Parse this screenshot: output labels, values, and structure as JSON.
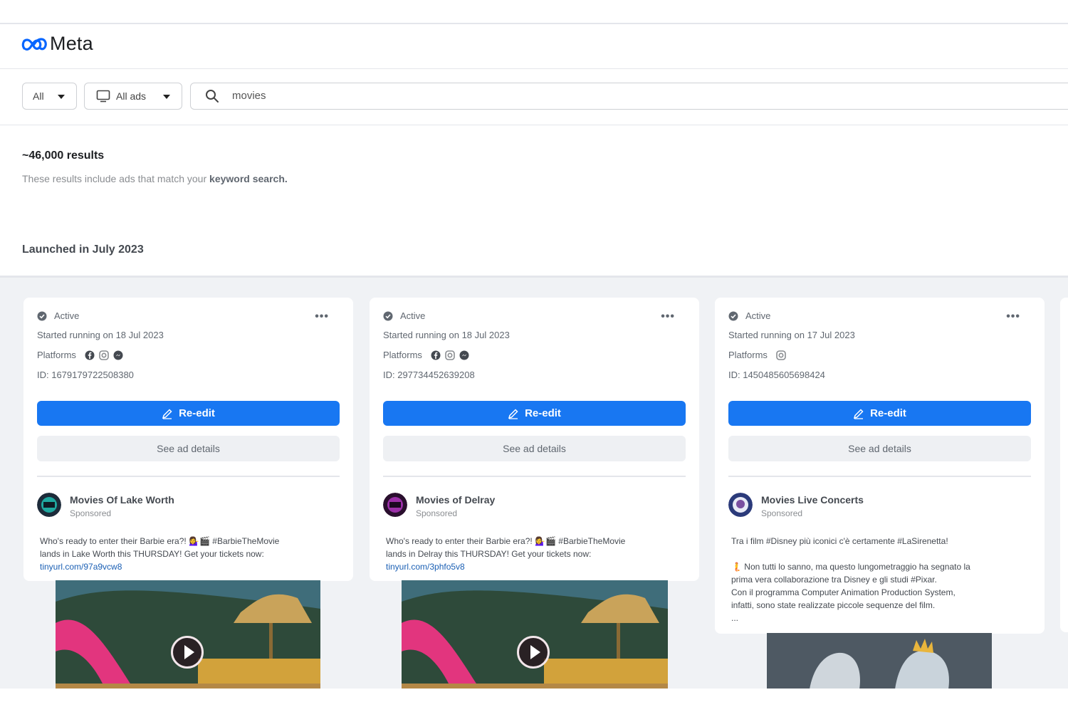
{
  "app": {
    "logo_text": "Meta"
  },
  "filters": {
    "country": "All",
    "ad_category": "All ads",
    "search_value": "movies"
  },
  "results": {
    "count_label": "~46,000 results",
    "note_prefix": "These results include ads that match your",
    "note_emphasis": "keyword search."
  },
  "section": {
    "title": "Launched in July 2023"
  },
  "colors": {
    "accent": "#1877f2",
    "background": "#f0f2f5"
  },
  "cards": [
    {
      "status": "Active",
      "started": "Started running on 18 Jul 2023",
      "platforms_label": "Platforms",
      "platforms": [
        "facebook-icon",
        "instagram-icon",
        "messenger-icon"
      ],
      "id": "ID: 1679179722508380",
      "reedit_label": "Re-edit",
      "details_label": "See ad details",
      "advertiser": "Movies Of Lake Worth",
      "sponsored": "Sponsored",
      "text_line1": "Who's ready to enter their Barbie era?! 💁‍♀️🎬 #BarbieTheMovie",
      "text_line2": "lands in Lake Worth this THURSDAY! Get your tickets now:",
      "link": "tinyurl.com/97a9vcw8"
    },
    {
      "status": "Active",
      "started": "Started running on 18 Jul 2023",
      "platforms_label": "Platforms",
      "platforms": [
        "facebook-icon",
        "instagram-icon",
        "messenger-icon"
      ],
      "id": "ID: 297734452639208",
      "reedit_label": "Re-edit",
      "details_label": "See ad details",
      "advertiser": "Movies of Delray",
      "sponsored": "Sponsored",
      "text_line1": "Who's ready to enter their Barbie era?! 💁‍♀️🎬 #BarbieTheMovie",
      "text_line2": "lands in Delray this THURSDAY! Get your tickets now:",
      "link": "tinyurl.com/3phfo5v8"
    },
    {
      "status": "Active",
      "started": "Started running on 17 Jul 2023",
      "platforms_label": "Platforms",
      "platforms": [
        "instagram-icon"
      ],
      "id": "ID: 1450485605698424",
      "reedit_label": "Re-edit",
      "details_label": "See ad details",
      "advertiser": "Movies Live Concerts",
      "sponsored": "Sponsored",
      "text_line1": "Tra i film #Disney più iconici c'è certamente #LaSirenetta!",
      "text_line2": "🧜 Non tutti lo sanno, ma questo lungometraggio ha segnato la",
      "text_line3": "prima vera collaborazione tra Disney e gli studi #Pixar.",
      "text_line4": "Con il programma Computer Animation Production System,",
      "text_line5": "infatti, sono state realizzate piccole sequenze del film.",
      "text_line6": "..."
    }
  ]
}
